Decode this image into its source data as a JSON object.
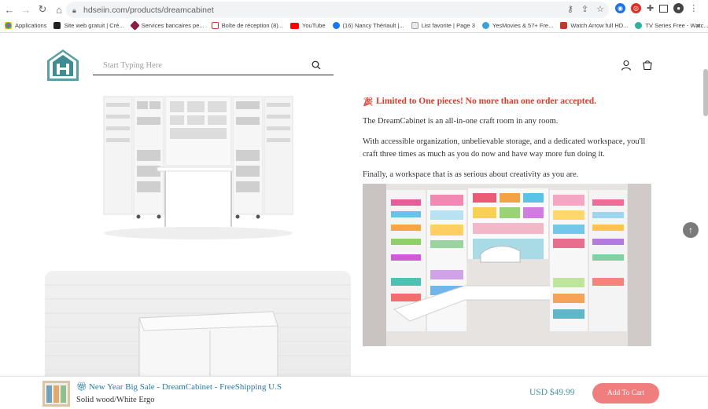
{
  "browser": {
    "url": "hdseiin.com/products/dreamcabinet",
    "bookmarks": [
      {
        "label": "Applications",
        "color": "#5f6368"
      },
      {
        "label": "Site web gratuit | Cré...",
        "color": "#222222"
      },
      {
        "label": "Services bancaires pe...",
        "color": "#8b1e3f"
      },
      {
        "label": "Boîte de réception (8)...",
        "color": "#d93025"
      },
      {
        "label": "YouTube",
        "color": "#ff0000"
      },
      {
        "label": "(16) Nancy Thériault |...",
        "color": "#1877f2"
      },
      {
        "label": "List favorite | Page 3",
        "color": "#9aa0a6"
      },
      {
        "label": "YesMovies & 57+ Fre...",
        "color": "#3aa0d8"
      },
      {
        "label": "Watch Arrow full HD...",
        "color": "#c0392b"
      },
      {
        "label": "TV Series Free - Watc...",
        "color": "#2bb3a0"
      }
    ]
  },
  "header": {
    "search_placeholder": "Start Typing Here"
  },
  "product": {
    "limited_text": "Limited to One pieces! No more than one order accepted.",
    "para1": "The DreamCabinet is an all-in-one craft room in any room.",
    "para2": "With accessible organization, unbelievable storage, and a dedicated workspace, you'll craft three times as much as you do now and have way more fun doing it.",
    "para3": "Finally, a workspace that is as serious about creativity as you are."
  },
  "sticky": {
    "title": "New Year Big Sale - DreamCabinet - FreeShipping U.S",
    "variant": "Solid wood/White Ergo",
    "price": "USD $49.99",
    "button": "Add To Cart"
  },
  "colors": {
    "accent_red": "#e0392b",
    "link_blue": "#1f7fb0",
    "cart_button": "#f07e7e",
    "price_teal": "#4a95a5",
    "logo_teal": "#3e8d95"
  }
}
